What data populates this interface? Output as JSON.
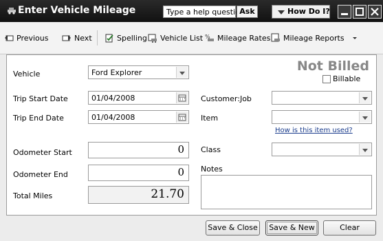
{
  "window": {
    "title": "Enter Vehicle Mileage",
    "help_placeholder": "Type a help question",
    "ask_label": "Ask",
    "how_do_i_label": "How Do I?"
  },
  "toolbar": {
    "previous": "Previous",
    "next": "Next",
    "spelling": "Spelling",
    "vehicle_list": "Vehicle List",
    "mileage_rates": "Mileage Rates",
    "mileage_reports": "Mileage Reports"
  },
  "form": {
    "status": "Not Billed",
    "billable_label": "Billable",
    "billable_checked": false,
    "vehicle_label": "Vehicle",
    "vehicle_value": "Ford Explorer",
    "trip_start_label": "Trip Start Date",
    "trip_start_value": "01/04/2008",
    "trip_end_label": "Trip End Date",
    "trip_end_value": "01/04/2008",
    "odometer_start_label": "Odometer Start",
    "odometer_start_value": "0",
    "odometer_end_label": "Odometer End",
    "odometer_end_value": "0",
    "total_miles_label": "Total Miles",
    "total_miles_value": "21.70",
    "customer_job_label": "Customer:Job",
    "customer_job_value": "",
    "item_label": "Item",
    "item_value": "",
    "item_help_link": "How is this item used?",
    "class_label": "Class",
    "class_value": "",
    "notes_label": "Notes",
    "notes_value": ""
  },
  "buttons": {
    "save_close": "Save & Close",
    "save_new": "Save & New",
    "clear": "Clear"
  },
  "colors": {
    "titlebar": "#1a1a1a",
    "status_text": "#888888",
    "link": "#1a3c8c"
  }
}
